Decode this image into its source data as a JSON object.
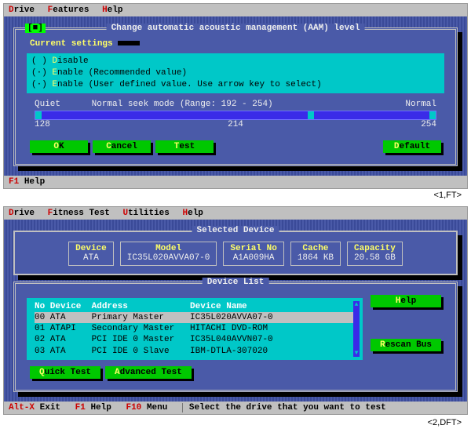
{
  "s1": {
    "menu": {
      "drive": "Drive",
      "features": "Features",
      "help": "Help"
    },
    "dialog": {
      "close": "[■]",
      "title": "Change automatic acoustic management (AAM) level",
      "legend": "Current settings",
      "opts": {
        "o1": "( ) Disable",
        "o2": "(·) Enable (Recommended value)",
        "o3": "(·) Enable (User defined value. Use arrow key to select)"
      },
      "seek": {
        "quiet": "Quiet",
        "label": "Normal seek mode (Range: 192 - 254)",
        "normal": "Normal",
        "low": "128",
        "mid": "214",
        "high": "254"
      },
      "buttons": {
        "ok": "OK",
        "cancel": "Cancel",
        "test": "Test",
        "def": "Default"
      }
    },
    "status": {
      "f1": "F1",
      "help": "Help"
    },
    "caption": "<1,FT>"
  },
  "s2": {
    "menu": {
      "drive": "Drive",
      "fit": "Fitness Test",
      "util": "Utilities",
      "help": "Help"
    },
    "selected": {
      "title": "Selected Device",
      "device_h": "Device",
      "device_v": "ATA",
      "model_h": "Model",
      "model_v": "IC35L020AVVA07-0",
      "serial_h": "Serial No",
      "serial_v": "A1A009HA",
      "cache_h": "Cache",
      "cache_v": "1864 KB",
      "cap_h": "Capacity",
      "cap_v": "20.58 GB"
    },
    "list": {
      "title": "Device List",
      "head": "No Device  Address            Device Name",
      "rows": [
        "00 ATA     Primary Master     IC35L020AVVA07-0",
        "01 ATAPI   Secondary Master   HITACHI DVD-ROM",
        "02 ATA     PCI IDE 0 Master   IC35L040AVVN07-0",
        "03 ATA     PCI IDE 0 Slave    IBM-DTLA-307020"
      ],
      "buttons": {
        "help": "Help",
        "rescan": "Rescan Bus",
        "qt": "Quick Test",
        "adv": "Advanced Test"
      }
    },
    "status": {
      "altx": "Alt-X",
      "exit": "Exit",
      "f1": "F1",
      "help": "Help",
      "f10": "F10",
      "menu": "Menu",
      "hint": "Select the drive that you want to test"
    },
    "caption": "<2,DFT>"
  }
}
